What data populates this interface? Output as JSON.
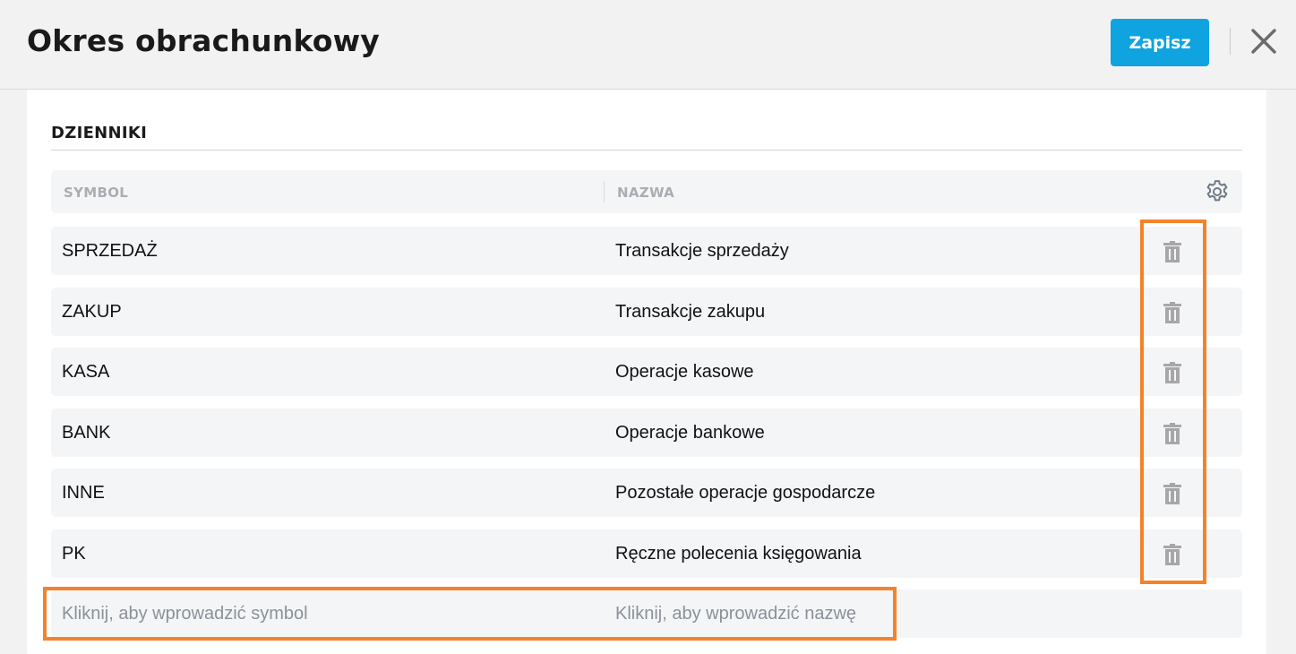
{
  "header": {
    "title": "Okres obrachunkowy",
    "save_label": "Zapisz",
    "close_icon": "close-icon"
  },
  "section": {
    "title": "DZIENNIKI"
  },
  "table": {
    "columns": [
      "SYMBOL",
      "NAZWA"
    ],
    "settings_icon": "gear-icon",
    "rows": [
      {
        "symbol": "SPRZEDAŻ",
        "nazwa": "Transakcje sprzedaży"
      },
      {
        "symbol": "ZAKUP",
        "nazwa": "Transakcje zakupu"
      },
      {
        "symbol": "KASA",
        "nazwa": "Operacje kasowe"
      },
      {
        "symbol": "BANK",
        "nazwa": "Operacje bankowe"
      },
      {
        "symbol": "INNE",
        "nazwa": "Pozostałe operacje gospodarcze"
      },
      {
        "symbol": "PK",
        "nazwa": "Ręczne polecenia księgowania"
      }
    ],
    "new_row": {
      "symbol_placeholder": "Kliknij, aby wprowadzić symbol",
      "nazwa_placeholder": "Kliknij, aby wprowadzić nazwę"
    }
  },
  "colors": {
    "accent": "#0fa3e0",
    "highlight": "#f5822a",
    "row_bg": "#f4f5f7",
    "icon_gray": "#a7a7a7"
  }
}
